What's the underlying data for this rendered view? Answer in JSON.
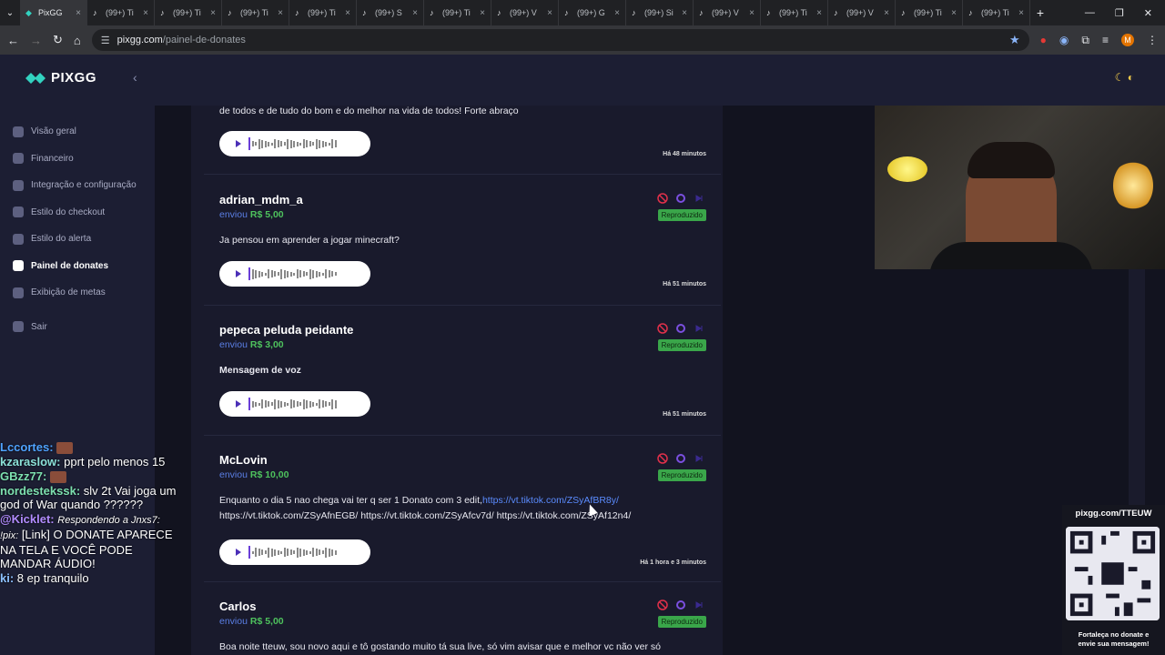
{
  "browser": {
    "tabs": [
      {
        "label": "PixGG",
        "active": true
      },
      {
        "label": "(99+) Ti"
      },
      {
        "label": "(99+) Ti"
      },
      {
        "label": "(99+) Ti"
      },
      {
        "label": "(99+) Ti"
      },
      {
        "label": "(99+) S"
      },
      {
        "label": "(99+) Ti"
      },
      {
        "label": "(99+) V"
      },
      {
        "label": "(99+) G"
      },
      {
        "label": "(99+) Si"
      },
      {
        "label": "(99+) V"
      },
      {
        "label": "(99+) Ti"
      },
      {
        "label": "(99+) V"
      },
      {
        "label": "(99+) Ti"
      },
      {
        "label": "(99+) Ti"
      }
    ],
    "url_host": "pixgg.com",
    "url_path": "/painel-de-donates",
    "profile_initial": "M"
  },
  "brand": {
    "name": "PIXGG"
  },
  "nav": [
    {
      "label": "Visão geral"
    },
    {
      "label": "Financeiro"
    },
    {
      "label": "Integração e configuração"
    },
    {
      "label": "Estilo do checkout"
    },
    {
      "label": "Estilo do alerta"
    },
    {
      "label": "Painel de donates",
      "active": true
    },
    {
      "label": "Exibição de metas"
    },
    {
      "label": "Sair"
    }
  ],
  "donations": {
    "d0": {
      "message": "de todos e de tudo do bom e do melhor na vida de todos! Forte abraço",
      "time": "Há 48 minutos"
    },
    "d1": {
      "name": "adrian_mdm_a",
      "sent": "enviou",
      "amount": "R$ 5,00",
      "message": "Ja pensou em aprender a jogar minecraft?",
      "time": "Há 51 minutos",
      "status": "Reproduzido"
    },
    "d2": {
      "name": "pepeca peluda peidante",
      "sent": "enviou",
      "amount": "R$ 3,00",
      "message": "Mensagem de voz",
      "time": "Há 51 minutos",
      "status": "Reproduzido"
    },
    "d3": {
      "name": "McLovin",
      "sent": "enviou",
      "amount": "R$ 10,00",
      "message": "Enquanto o dia 5 nao chega vai ter q ser 1 Donato com 3 edit,",
      "link1": "https://vt.tiktok.com/ZSyAfBR8y/",
      "links2": "https://vt.tiktok.com/ZSyAfnEGB/ https://vt.tiktok.com/ZSyAfcv7d/ https://vt.tiktok.com/ZSyAf12n4/",
      "time": "Há 1 hora e 3 minutos",
      "status": "Reproduzido"
    },
    "d4": {
      "name": "Carlos",
      "sent": "enviou",
      "amount": "R$ 5,00",
      "message": "Boa noite tteuw, sou novo aqui e tô gostando muito tá sua live, só vim avisar que e melhor vc não ver só",
      "status": "Reproduzido"
    }
  },
  "chat": {
    "l1_user": "Lccortes:",
    "l2_user": "kzaraslow:",
    "l2_text": "pprt pelo menos 15",
    "l3_user": "GBzz77:",
    "l4_user": "nordestekssk:",
    "l4_text": "slv 2t Vai joga um god of War quando ??????",
    "l5_user": "@Kicklet:",
    "l5_reply": "Respondendo a Jnxs7:",
    "l5_prefix": "!pix:",
    "l5_text": "[Link] O DONATE APARECE NA TELA E VOCÊ PODE MANDAR ÁUDIO!",
    "l6_user": "ki:",
    "l6_text": "8 ep tranquilo"
  },
  "qr": {
    "title": "pixgg.com/TTEUW",
    "footer1": "Fortaleça no donate e",
    "footer2": "envie sua mensagem!"
  },
  "colors": {
    "accent": "#5b7fe6",
    "amount": "#4ec25d",
    "badge": "#3aa64a",
    "block": "#e0304a",
    "replay": "#7b4fe0"
  },
  "icons": [
    "dropdown-icon",
    "tiktok-icon",
    "back-icon",
    "forward-icon",
    "reload-icon",
    "home-icon",
    "star-icon",
    "home-nav-icon",
    "wallet-icon",
    "integration-icon",
    "checkout-icon",
    "alert-icon",
    "donates-icon",
    "star-goal-icon",
    "logout-icon",
    "block-icon",
    "replay-icon",
    "skip-icon",
    "play-icon",
    "moon-icon"
  ]
}
